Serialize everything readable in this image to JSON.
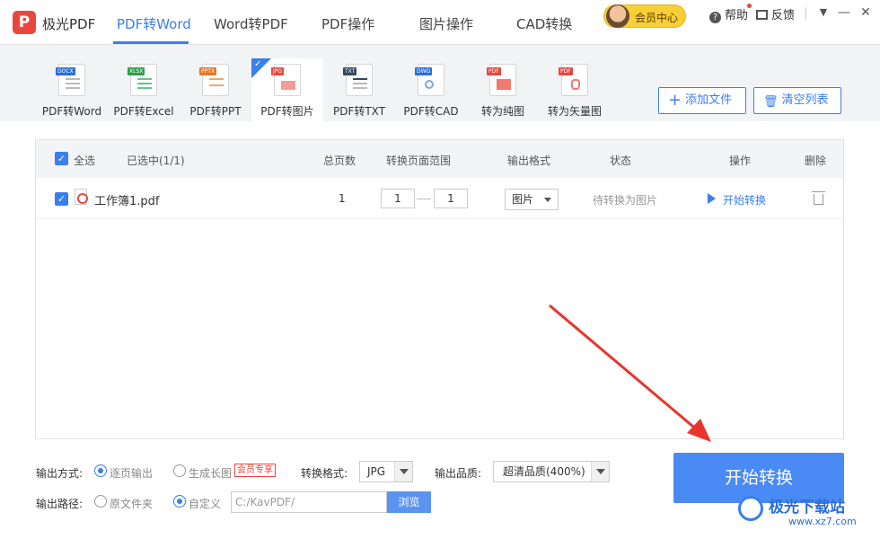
{
  "app": {
    "name": "极光PDF",
    "logo_letter": "P"
  },
  "nav": {
    "tabs": [
      "PDF转Word",
      "Word转PDF",
      "PDF操作",
      "图片操作",
      "CAD转换"
    ],
    "active_index": 0
  },
  "topbar": {
    "vip_label": "会员中心",
    "help_label": "帮助",
    "feedback_label": "反馈",
    "minimize": "—",
    "menu": "▼",
    "close": "✕"
  },
  "tools": {
    "items": [
      {
        "label": "PDF转Word",
        "tag": "DOCX",
        "tag_color": "#2b6fd6"
      },
      {
        "label": "PDF转Excel",
        "tag": "XLSX",
        "tag_color": "#2e9e4f"
      },
      {
        "label": "PDF转PPT",
        "tag": "PPTX",
        "tag_color": "#e07a2b"
      },
      {
        "label": "PDF转图片",
        "tag": "JPG",
        "tag_color": "#e8483c"
      },
      {
        "label": "PDF转TXT",
        "tag": "TXT",
        "tag_color": "#34495e"
      },
      {
        "label": "PDF转CAD",
        "tag": "DWG",
        "tag_color": "#2b6fd6"
      },
      {
        "label": "转为纯图",
        "tag": "PDF",
        "tag_color": "#e8483c"
      },
      {
        "label": "转为矢量图",
        "tag": "PDF",
        "tag_color": "#e8483c"
      }
    ],
    "active_index": 3,
    "add_file": "添加文件",
    "clear_list": "清空列表"
  },
  "table": {
    "headers": {
      "select_all": "全选",
      "selected": "已选中(1/1)",
      "pages": "总页数",
      "range": "转换页面范围",
      "format": "输出格式",
      "status": "状态",
      "action": "操作",
      "delete": "删除"
    },
    "rows": [
      {
        "filename": "工作簿1.pdf",
        "pages": "1",
        "from": "1",
        "to": "1",
        "format": "图片",
        "status": "待转换为图片",
        "action": "开始转换"
      }
    ]
  },
  "bottom": {
    "output_mode_label": "输出方式:",
    "mode_page": "逐页输出",
    "mode_long": "生成长图",
    "vip_badge": "会员专享",
    "format_label": "转换格式:",
    "format_value": "JPG",
    "quality_label": "输出品质:",
    "quality_value": "超清品质(400%)",
    "path_label": "输出路径:",
    "path_original": "原文件夹",
    "path_custom": "自定义",
    "path_value": "C:/KavPDF/",
    "browse": "浏览",
    "start": "开始转换"
  },
  "watermark": {
    "title": "极光下载站",
    "url": "www.xz7.com"
  },
  "colors": {
    "accent": "#3a7ef0",
    "start_button": "#4a8af4",
    "arrow": "#e8352b"
  }
}
